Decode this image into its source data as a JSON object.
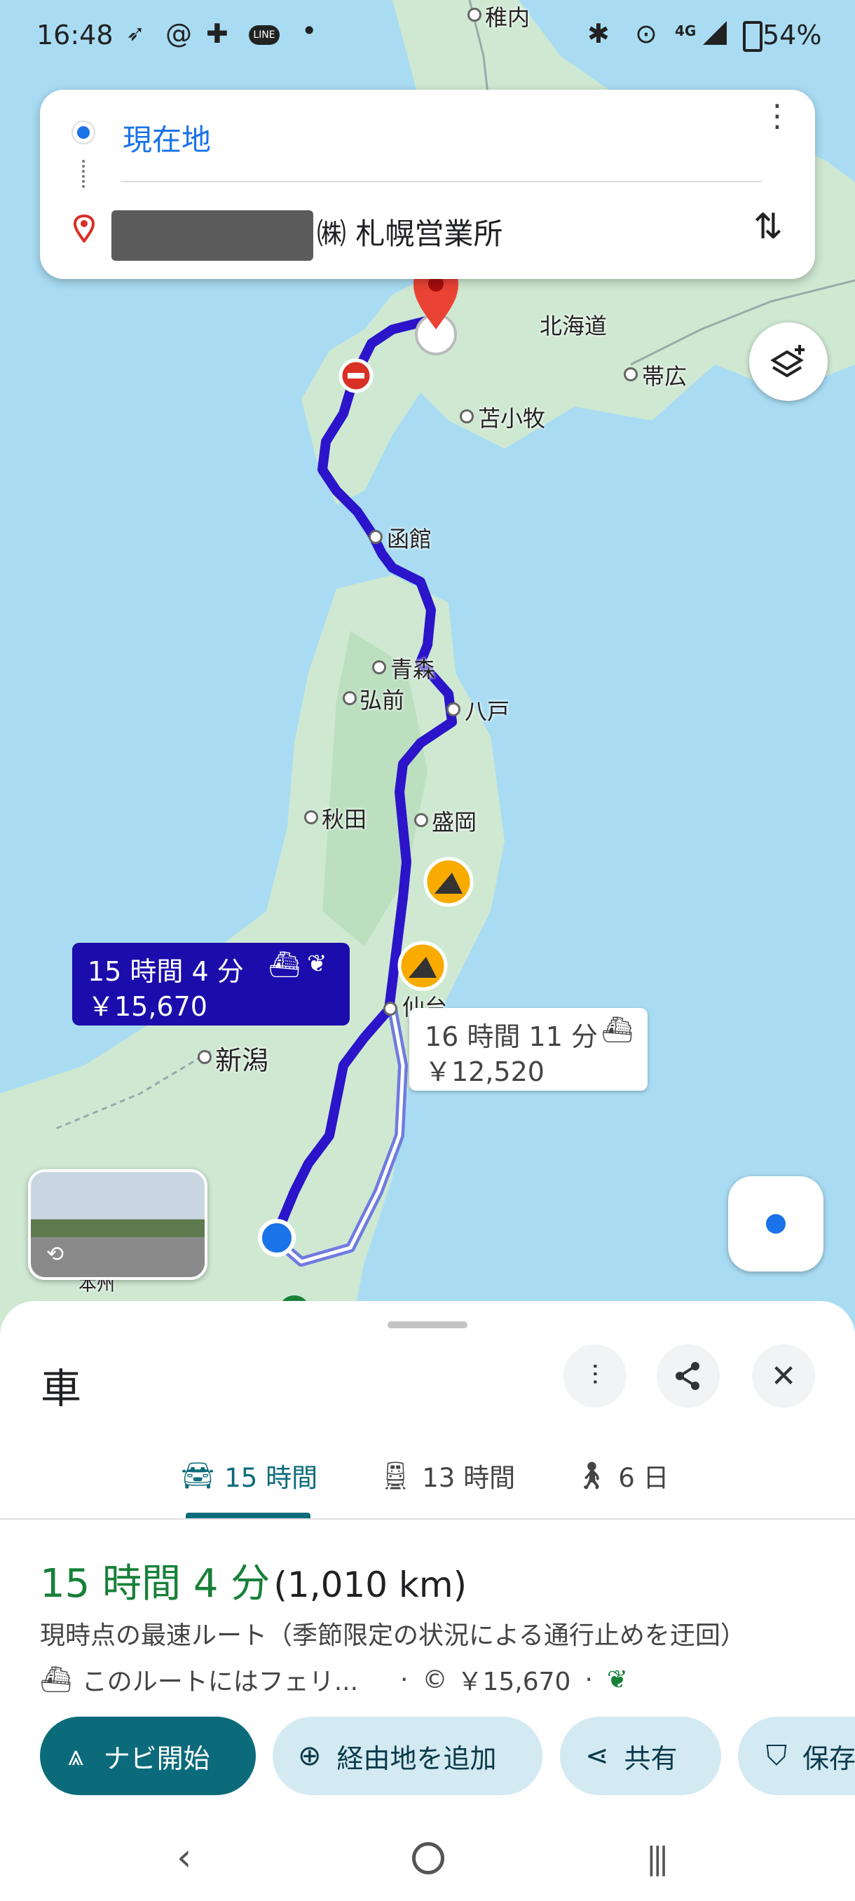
{
  "status_bar": {
    "time": "16:48",
    "network": "4G",
    "battery": "54%"
  },
  "search": {
    "origin": "現在地",
    "destination": "㈱ 札幌営業所"
  },
  "map": {
    "cities": [
      {
        "name": "稚内"
      },
      {
        "name": "北海道"
      },
      {
        "name": "帯広"
      },
      {
        "name": "苫小牧"
      },
      {
        "name": "函館"
      },
      {
        "name": "青森"
      },
      {
        "name": "弘前"
      },
      {
        "name": "八戸"
      },
      {
        "name": "秋田"
      },
      {
        "name": "盛岡"
      },
      {
        "name": "仙台"
      },
      {
        "name": "新潟"
      },
      {
        "name": "本州"
      }
    ]
  },
  "callouts": {
    "main": {
      "duration": "15 時間 4 分",
      "price": "￥15,670"
    },
    "alt": {
      "duration": "16 時間 11 分",
      "price": "￥12,520"
    }
  },
  "sheet": {
    "mode_title": "車",
    "tabs": [
      {
        "label": "15 時間"
      },
      {
        "label": "13 時間"
      },
      {
        "label": "6 日"
      }
    ],
    "summary": {
      "duration": "15 時間 4 分",
      "distance": "(1,010 km)",
      "note": "現時点の最速ルート（季節限定の状況による通行止めを迂回）",
      "ferry": "このルートにはフェリ...",
      "toll": "￥15,670"
    },
    "actions": {
      "navigate": "ナビ開始",
      "add_stop": "経由地を追加",
      "share": "共有",
      "save": "保存"
    }
  },
  "colors": {
    "route": "#2b14c9",
    "accent": "#0b6b7a",
    "duration_green": "#188038"
  }
}
